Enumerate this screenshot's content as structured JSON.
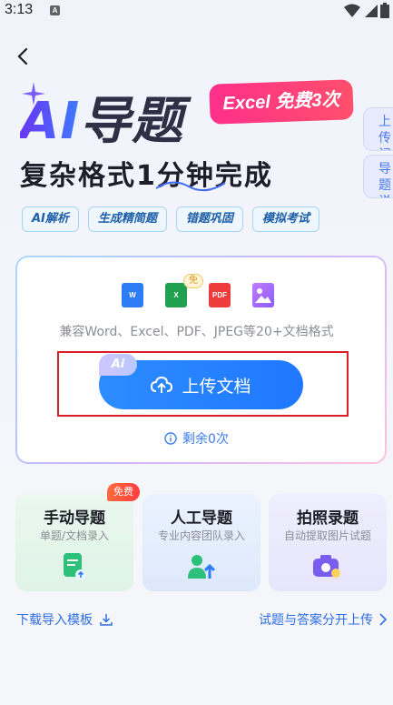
{
  "status": {
    "time": "3:13",
    "notif": "A"
  },
  "hero": {
    "ai": "AI",
    "rest": "导题",
    "badge": "Excel 免费3次",
    "subtitle": "复杂格式1分钟完成"
  },
  "side_tabs": [
    {
      "label": "上传记录"
    },
    {
      "label": "导题说明"
    }
  ],
  "tags": [
    "AI解析",
    "生成精简题",
    "错题巩固",
    "模拟考试"
  ],
  "upload": {
    "icons": [
      {
        "name": "word-file-icon",
        "text": "W"
      },
      {
        "name": "excel-file-icon",
        "text": "X"
      },
      {
        "name": "pdf-file-icon",
        "text": "PDF"
      },
      {
        "name": "image-file-icon",
        "text": ""
      }
    ],
    "free_mini": "免",
    "compat": "兼容Word、Excel、PDF、JPEG等20+文档格式",
    "ai_chip": "Ai",
    "button": "上传文档",
    "remaining": "剩余0次"
  },
  "cards": [
    {
      "title": "手动导题",
      "sub": "单题/文档录入",
      "badge": "免费"
    },
    {
      "title": "人工导题",
      "sub": "专业内容团队录入"
    },
    {
      "title": "拍照录题",
      "sub": "自动提取图片试题"
    }
  ],
  "links": {
    "left": "下载导入模板",
    "right": "试题与答案分开上传"
  },
  "colors": {
    "accent": "#1f78ff",
    "badge": "#ff2f8a",
    "highlight": "#d91f2a"
  }
}
